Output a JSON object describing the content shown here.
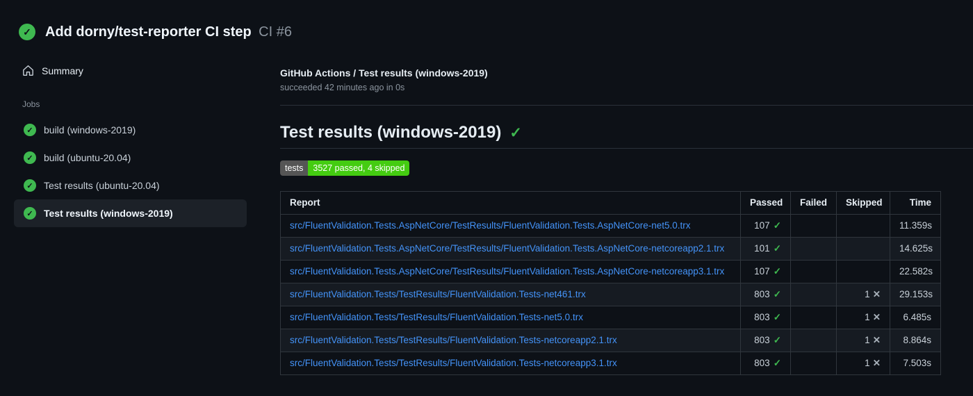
{
  "colors": {
    "page_bg": "#0d1117",
    "accent_green": "#3fb950",
    "link_blue": "#4493f8",
    "selected_item_bg": "#1c2128",
    "badge_label_bg": "#555555",
    "badge_value_bg": "#44cc11",
    "table_border": "#30363d",
    "table_alt_row_bg": "#161b22"
  },
  "header": {
    "title": "Add dorny/test-reporter CI step",
    "run_ref": "CI #6",
    "check_glyph": "✓"
  },
  "sidebar": {
    "summary_label": "Summary",
    "jobs_heading": "Jobs",
    "jobs": [
      {
        "label": "build (windows-2019)",
        "selected": false
      },
      {
        "label": "build (ubuntu-20.04)",
        "selected": false
      },
      {
        "label": "Test results (ubuntu-20.04)",
        "selected": false
      },
      {
        "label": "Test results (windows-2019)",
        "selected": true
      }
    ]
  },
  "main": {
    "breadcrumb": "GitHub Actions / Test results (windows-2019)",
    "status_line": "succeeded 42 minutes ago in 0s",
    "section_title": "Test results (windows-2019)",
    "section_check_glyph": "✓",
    "badge": {
      "label": "tests",
      "value": "3527 passed, 4 skipped"
    },
    "table": {
      "columns": [
        "Report",
        "Passed",
        "Failed",
        "Skipped",
        "Time"
      ],
      "pass_glyph": "✓",
      "skip_glyph": "✕",
      "rows": [
        {
          "report": "src/FluentValidation.Tests.AspNetCore/TestResults/FluentValidation.Tests.AspNetCore-net5.0.trx",
          "passed": "107",
          "failed": "",
          "skipped": "",
          "time": "11.359s"
        },
        {
          "report": "src/FluentValidation.Tests.AspNetCore/TestResults/FluentValidation.Tests.AspNetCore-netcoreapp2.1.trx",
          "passed": "101",
          "failed": "",
          "skipped": "",
          "time": "14.625s"
        },
        {
          "report": "src/FluentValidation.Tests.AspNetCore/TestResults/FluentValidation.Tests.AspNetCore-netcoreapp3.1.trx",
          "passed": "107",
          "failed": "",
          "skipped": "",
          "time": "22.582s"
        },
        {
          "report": "src/FluentValidation.Tests/TestResults/FluentValidation.Tests-net461.trx",
          "passed": "803",
          "failed": "",
          "skipped": "1",
          "time": "29.153s"
        },
        {
          "report": "src/FluentValidation.Tests/TestResults/FluentValidation.Tests-net5.0.trx",
          "passed": "803",
          "failed": "",
          "skipped": "1",
          "time": "6.485s"
        },
        {
          "report": "src/FluentValidation.Tests/TestResults/FluentValidation.Tests-netcoreapp2.1.trx",
          "passed": "803",
          "failed": "",
          "skipped": "1",
          "time": "8.864s"
        },
        {
          "report": "src/FluentValidation.Tests/TestResults/FluentValidation.Tests-netcoreapp3.1.trx",
          "passed": "803",
          "failed": "",
          "skipped": "1",
          "time": "7.503s"
        }
      ]
    }
  }
}
